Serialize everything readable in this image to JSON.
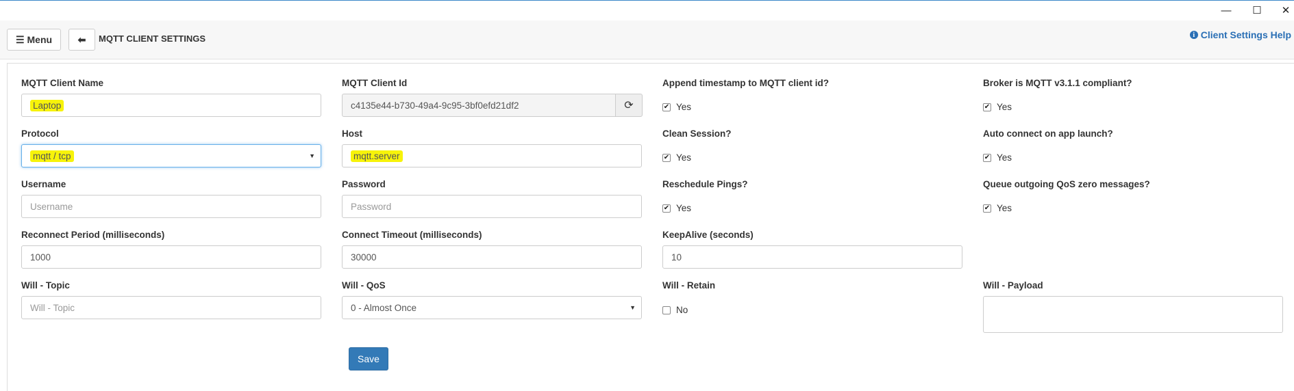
{
  "window": {
    "minimize_icon": "—",
    "maximize_icon": "☐",
    "close_icon": "✕"
  },
  "header": {
    "menu_label": "Menu",
    "title": "MQTT CLIENT SETTINGS",
    "help_label": "Client Settings Help"
  },
  "form": {
    "client_name": {
      "label": "MQTT Client Name",
      "value": "Laptop"
    },
    "client_id": {
      "label": "MQTT Client Id",
      "value": "c4135e44-b730-49a4-9c95-3bf0efd21df2"
    },
    "append_timestamp": {
      "label": "Append timestamp to MQTT client id?",
      "option": "Yes",
      "checked": true
    },
    "broker_compliant": {
      "label": "Broker is MQTT v3.1.1 compliant?",
      "option": "Yes",
      "checked": true
    },
    "protocol": {
      "label": "Protocol",
      "value": "mqtt / tcp"
    },
    "host": {
      "label": "Host",
      "value": "mqtt.server"
    },
    "clean_session": {
      "label": "Clean Session?",
      "option": "Yes",
      "checked": true
    },
    "auto_connect": {
      "label": "Auto connect on app launch?",
      "option": "Yes",
      "checked": true
    },
    "username": {
      "label": "Username",
      "placeholder": "Username"
    },
    "password": {
      "label": "Password",
      "placeholder": "Password"
    },
    "reschedule_pings": {
      "label": "Reschedule Pings?",
      "option": "Yes",
      "checked": true
    },
    "queue_qos_zero": {
      "label": "Queue outgoing QoS zero messages?",
      "option": "Yes",
      "checked": true
    },
    "reconnect_period": {
      "label": "Reconnect Period (milliseconds)",
      "value": "1000"
    },
    "connect_timeout": {
      "label": "Connect Timeout (milliseconds)",
      "value": "30000"
    },
    "keepalive": {
      "label": "KeepAlive (seconds)",
      "value": "10"
    },
    "will_topic": {
      "label": "Will - Topic",
      "placeholder": "Will - Topic"
    },
    "will_qos": {
      "label": "Will - QoS",
      "value": "0 - Almost Once"
    },
    "will_retain": {
      "label": "Will - Retain",
      "option": "No",
      "checked": false
    },
    "will_payload": {
      "label": "Will - Payload"
    },
    "save_label": "Save"
  },
  "colors": {
    "primary": "#337ab7",
    "link": "#2a6fb5",
    "highlight": "#f7f30a"
  }
}
